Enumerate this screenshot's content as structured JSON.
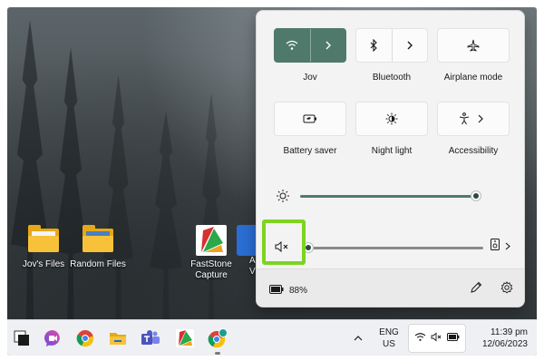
{
  "desktop": {
    "icons": [
      {
        "label": "Jov's Files",
        "icon": "folder-icon"
      },
      {
        "label": "Random Files",
        "icon": "folder-icon"
      },
      {
        "label": "FastStone\nCapture",
        "icon": "faststone-capture-icon"
      },
      {
        "label": "A\nV",
        "icon": "app-icon"
      }
    ]
  },
  "quick_settings": {
    "tiles": [
      {
        "label": "Jov",
        "icon": "wifi-icon",
        "active": true,
        "has_chevron": true
      },
      {
        "label": "Bluetooth",
        "icon": "bluetooth-icon",
        "active": false,
        "has_chevron": true
      },
      {
        "label": "Airplane mode",
        "icon": "airplane-icon",
        "active": false,
        "has_chevron": false
      },
      {
        "label": "Battery saver",
        "icon": "battery-saver-icon",
        "active": false,
        "has_chevron": false
      },
      {
        "label": "Night light",
        "icon": "night-light-icon",
        "active": false,
        "has_chevron": false
      },
      {
        "label": "Accessibility",
        "icon": "accessibility-icon",
        "active": false,
        "has_chevron": true
      }
    ],
    "brightness": {
      "icon": "brightness-icon",
      "value": 1.0
    },
    "volume": {
      "icon": "volume-muted-icon",
      "value": 0.0,
      "output_icon": "speaker-output-icon"
    },
    "battery_percent": "88%",
    "accent_color": "#4f7a6b",
    "highlight_color": "#7ed321"
  },
  "taskbar": {
    "apps": [
      "start-icon",
      "messenger-icon",
      "chrome-icon",
      "file-explorer-icon",
      "teams-icon",
      "faststone-capture-icon",
      "chrome-profile-icon"
    ],
    "language_line1": "ENG",
    "language_line2": "US",
    "time": "11:39 pm",
    "date": "12/06/2023"
  }
}
